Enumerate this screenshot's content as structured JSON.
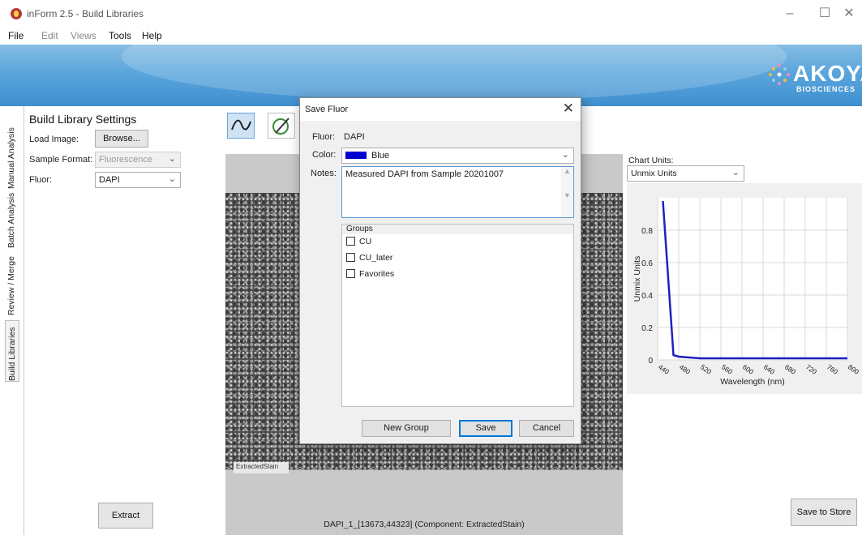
{
  "window": {
    "title": "inForm 2.5 - Build Libraries",
    "minimize": "–",
    "maximize": "☐",
    "close": "✕"
  },
  "menu": {
    "items": [
      {
        "label": "File",
        "enabled": true
      },
      {
        "label": "Edit",
        "enabled": false
      },
      {
        "label": "Views",
        "enabled": false
      },
      {
        "label": "Tools",
        "enabled": true
      },
      {
        "label": "Help",
        "enabled": true
      }
    ]
  },
  "banner": {
    "logo_text": "AKOYA",
    "logo_sub": "BIOSCIENCES"
  },
  "vertical_tabs": [
    {
      "label": "Manual Analysis",
      "active": false
    },
    {
      "label": "Batch Analysis",
      "active": false
    },
    {
      "label": "Review / Merge",
      "active": false
    },
    {
      "label": "Build Libraries",
      "active": true
    }
  ],
  "settings": {
    "title": "Build Library Settings",
    "load_image_label": "Load Image:",
    "browse_button": "Browse...",
    "sample_format_label": "Sample Format:",
    "sample_format_value": "Fluorescence",
    "fluor_label": "Fluor:",
    "fluor_value": "DAPI",
    "extract_button": "Extract"
  },
  "image": {
    "component_tag": "ExtractedStain",
    "caption": "DAPI_1_[13673,44323]  (Component: ExtractedStain)"
  },
  "chart_panel": {
    "units_label": "Chart Units:",
    "units_value": "Unmix Units",
    "save_to_store_button": "Save to Store"
  },
  "chart_data": {
    "type": "line",
    "title": "",
    "xlabel": "Wavelength (nm)",
    "ylabel": "Unmix Units",
    "xlim": [
      440,
      800
    ],
    "ylim": [
      0,
      1.0
    ],
    "x_ticks": [
      440,
      480,
      520,
      560,
      600,
      640,
      680,
      720,
      760,
      800
    ],
    "y_ticks": [
      0,
      0.2,
      0.4,
      0.6,
      0.8
    ],
    "y_tick_labels": [
      "0",
      "0.2",
      "0.4",
      "0.6",
      "0.8"
    ],
    "grid": true,
    "series": [
      {
        "color": "#2020c0",
        "x": [
          450,
          470,
          480,
          500,
          520,
          560,
          600,
          640,
          680,
          720,
          760,
          800
        ],
        "y": [
          0.98,
          0.03,
          0.02,
          0.015,
          0.01,
          0.01,
          0.01,
          0.01,
          0.01,
          0.01,
          0.01,
          0.01
        ]
      }
    ]
  },
  "dialog": {
    "title": "Save Fluor",
    "close": "✕",
    "fluor_label": "Fluor:",
    "fluor_value": "DAPI",
    "color_label": "Color:",
    "color_value": "Blue",
    "color_hex": "#0000d0",
    "notes_label": "Notes:",
    "notes_value": "Measured DAPI from Sample 20201007",
    "groups_header": "Groups",
    "groups": [
      {
        "label": "CU",
        "checked": false
      },
      {
        "label": "CU_later",
        "checked": false
      },
      {
        "label": "Favorites",
        "checked": false
      }
    ],
    "new_group_button": "New Group",
    "save_button": "Save",
    "cancel_button": "Cancel"
  }
}
